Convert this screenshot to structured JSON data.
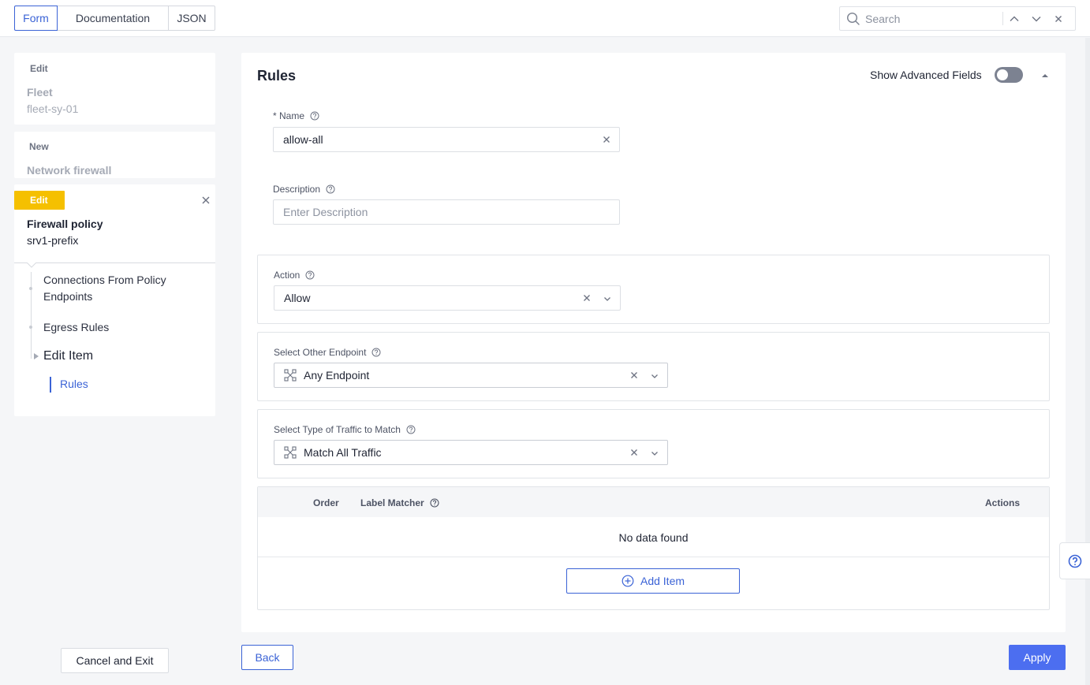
{
  "tabs": {
    "form": "Form",
    "documentation": "Documentation",
    "json": "JSON"
  },
  "search": {
    "placeholder": "Search"
  },
  "sidebar": {
    "fleet_card": {
      "tag": "Edit",
      "title": "Fleet",
      "value": "fleet-sy-01"
    },
    "network_card": {
      "tag": "New",
      "title": "Network firewall"
    },
    "policy_card": {
      "badge": "Edit",
      "title": "Firewall policy",
      "value": "srv1-prefix"
    },
    "tree": {
      "item1_line1": "Connections From Policy",
      "item1_line2": "Endpoints",
      "item2": "Egress Rules",
      "item3": "Edit Item",
      "item4": "Rules"
    },
    "cancel_label": "Cancel and Exit"
  },
  "main": {
    "title": "Rules",
    "advanced_label": "Show Advanced Fields",
    "advanced_enabled": false,
    "name": {
      "label": "* Name",
      "value": "allow-all"
    },
    "description": {
      "label": "Description",
      "placeholder": "Enter Description"
    },
    "action": {
      "label": "Action",
      "value": "Allow"
    },
    "endpoint": {
      "label": "Select Other Endpoint",
      "value": "Any Endpoint"
    },
    "traffic": {
      "label": "Select Type of Traffic to Match",
      "value": "Match All Traffic"
    },
    "table": {
      "col_order": "Order",
      "col_label_matcher": "Label Matcher",
      "col_actions": "Actions",
      "empty_text": "No data found",
      "add_label": "Add Item"
    }
  },
  "footer": {
    "back_label": "Back",
    "apply_label": "Apply"
  },
  "colors": {
    "accent": "#3b63d6",
    "apply": "#4c6ef0",
    "edit_badge": "#f5c000"
  }
}
